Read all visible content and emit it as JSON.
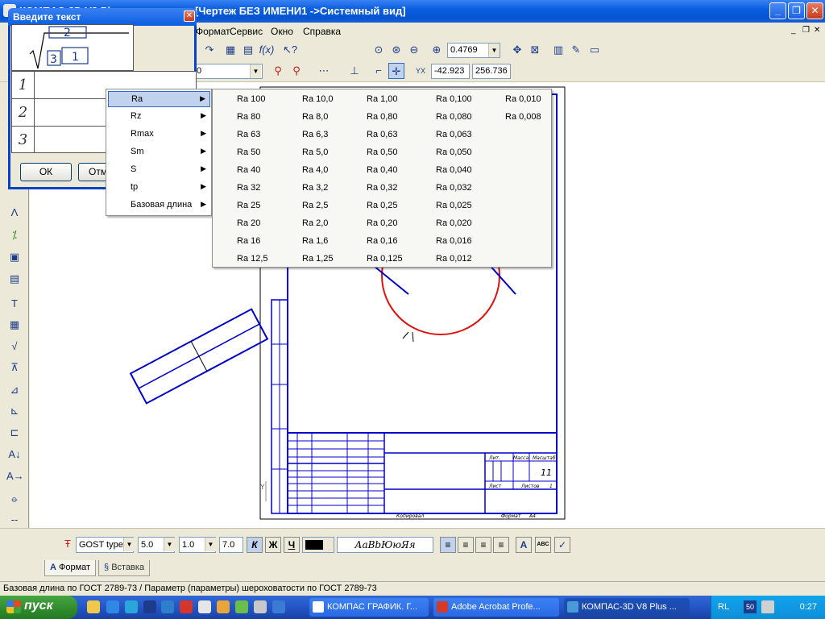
{
  "window": {
    "title_left": "КОМПАС-3D V8 Plus - ...",
    "title_right": "[Чертеж БЕЗ ИМЕНИ1 ->Системный вид]"
  },
  "menu": [
    "Формат",
    "Сервис",
    "Окно",
    "Справка"
  ],
  "toolbar": {
    "zoom_value": "0.4769",
    "coord_x": "-42.923",
    "coord_y": "256.736",
    "style_value": "0"
  },
  "dialog": {
    "title": "Введите текст",
    "preview_top": "2",
    "preview_left": "3",
    "preview_right": "1",
    "rows": [
      "1",
      "2",
      "3"
    ],
    "ok": "ОК",
    "cancel": "Отмена"
  },
  "context_menu": {
    "items": [
      "Ra",
      "Rz",
      "Rmax",
      "Sm",
      "S",
      "tp",
      "Базовая длина"
    ]
  },
  "submenu": {
    "columns": [
      [
        "Ra 100",
        "Ra 80",
        "Ra 63",
        "Ra 50",
        "Ra 40",
        "Ra 32",
        "Ra 25",
        "Ra 20",
        "Ra 16",
        "Ra 12,5"
      ],
      [
        "Ra 10,0",
        "Ra 8,0",
        "Ra 6,3",
        "Ra 5,0",
        "Ra 4,0",
        "Ra 3,2",
        "Ra 2,5",
        "Ra 2,0",
        "Ra 1,6",
        "Ra 1,25"
      ],
      [
        "Ra 1,00",
        "Ra 0,80",
        "Ra 0,63",
        "Ra 0,50",
        "Ra 0,40",
        "Ra 0,32",
        "Ra 0,25",
        "Ra 0,20",
        "Ra 0,16",
        "Ra 0,125"
      ],
      [
        "Ra 0,100",
        "Ra 0,080",
        "Ra 0,063",
        "Ra 0,050",
        "Ra 0,040",
        "Ra 0,032",
        "Ra 0,025",
        "Ra 0,020",
        "Ra 0,016",
        "Ra 0,012"
      ],
      [
        "Ra 0,010",
        "Ra 0,008"
      ]
    ]
  },
  "drawing": {
    "format_label": "Формат",
    "format_value": "А4",
    "copied_label": "Копировал",
    "sheet_number": "11",
    "sheet_label": "Лист",
    "sheets_label": "Листов",
    "sheets_value": "1",
    "lit_label": "Лит.",
    "mass_label": "Масса",
    "scale_label": "Масштаб"
  },
  "format_panel": {
    "font": "GOST type",
    "size": "5.0",
    "scale": "1.0",
    "step": "7.0",
    "preview": "АаВbЮюЯя",
    "bold": "К",
    "italic": "Ж",
    "underline": "Ч"
  },
  "tabs": [
    "Формат",
    "Вставка"
  ],
  "status": "Базовая длина по ГОСТ 2789-73 / Параметр (параметры) шероховатости по ГОСТ 2789-73",
  "taskbar": {
    "start": "пуск",
    "tasks": [
      "КОМПАС ГРАФИК. Г...",
      "Adobe Acrobat Profe...",
      "КОМПАС-3D V8 Plus ..."
    ],
    "lang": "RL",
    "time": "0:27",
    "tray_num": "50"
  },
  "colors": {
    "drawing_blue": "#0000cc",
    "drawing_red": "#e01010",
    "selection": "#c1d2ee"
  }
}
